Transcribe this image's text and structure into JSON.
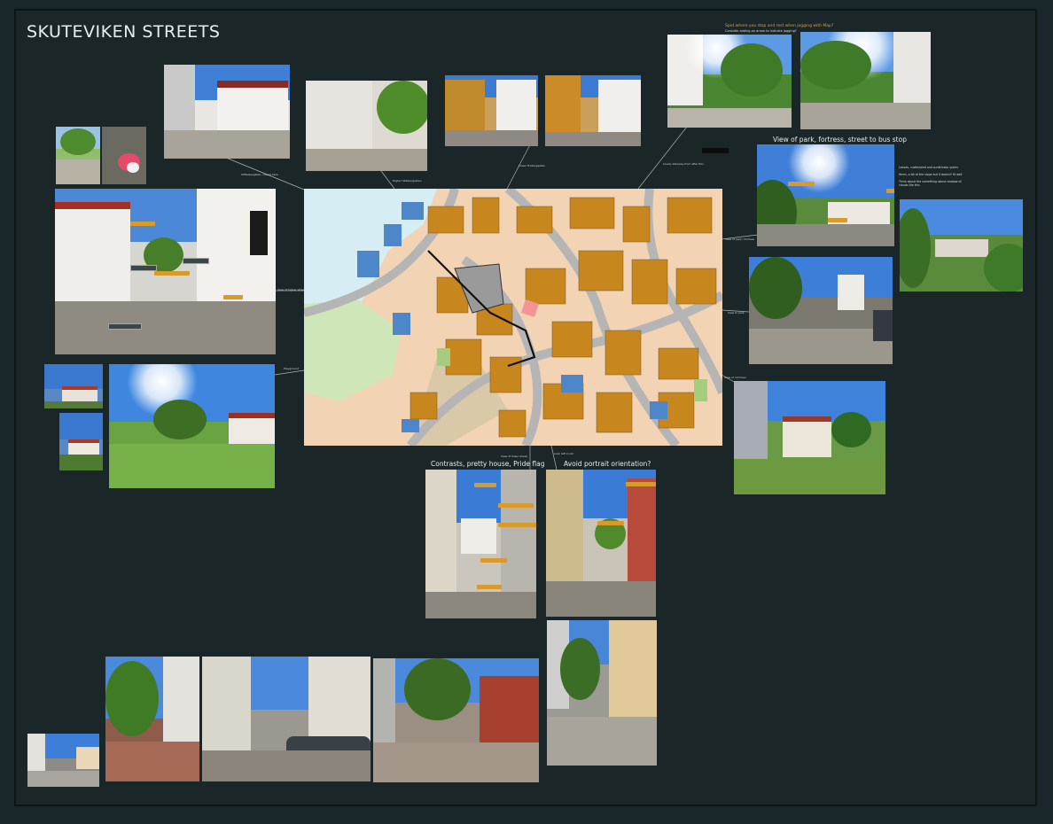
{
  "board": {
    "title": "SKUTEVIKEN STREETS"
  },
  "captions": {
    "view_park": "View of park, fortress, street to bus stop",
    "contrasts": "Contrasts, pretty house, Pride flag",
    "portrait": "Avoid portrait orientation?",
    "top_note": "Spot where you stop and rest when jogging with Map?",
    "top_subnote": "Consider adding an arrow to indicate jogging?"
  },
  "link_labels": {
    "l1": "Stiftelsesgaten, closed here",
    "l2": "Higher Skibbergsslien",
    "l3": "Lower Holbergsslien",
    "l4": "Lovely stairway from after this",
    "l5": "View of park / fortress",
    "l6": "View to park",
    "l7": "View of old town",
    "l8": "View of higher street",
    "l9": "Playground",
    "l10": "View of lower street",
    "l11": "Look left in old"
  },
  "side_notes": [
    "Leaves, rustle/wind and sunlit/color green",
    "Hmm, a bit of the slope but it doesn't fit well",
    "Think about the something about shadow of clouds like this"
  ],
  "colors": {
    "background": "#19272a",
    "accent": "#d89a2a",
    "map_building": "#c8861f",
    "map_blue": "#4d86c9",
    "map_bg": "#f2d3b3"
  }
}
